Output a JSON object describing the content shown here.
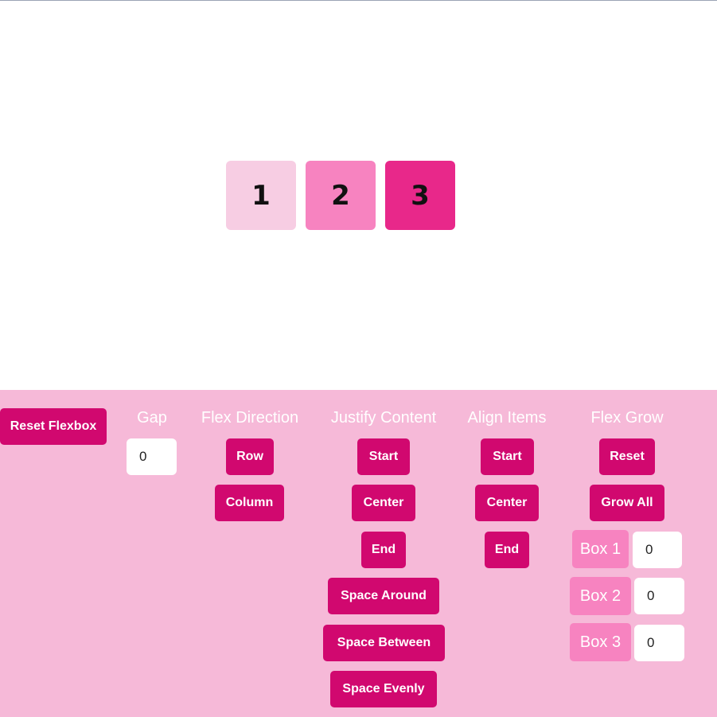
{
  "colors": {
    "box1": "#f7cde3",
    "box2": "#f783c0",
    "box3": "#e8288a",
    "button": "#d1086f",
    "panel": "#f6b9d8",
    "box_tag": "#f783c0"
  },
  "stage": {
    "boxes": [
      "1",
      "2",
      "3"
    ]
  },
  "controls": {
    "reset_flexbox": "Reset Flexbox",
    "gap": {
      "heading": "Gap",
      "value": "0"
    },
    "flex_direction": {
      "heading": "Flex Direction",
      "row": "Row",
      "column": "Column"
    },
    "justify_content": {
      "heading": "Justify Content",
      "start": "Start",
      "center": "Center",
      "end": "End",
      "space_around": "Space Around",
      "space_between": "Space Between",
      "space_evenly": "Space Evenly"
    },
    "align_items": {
      "heading": "Align Items",
      "start": "Start",
      "center": "Center",
      "end": "End"
    },
    "flex_grow": {
      "heading": "Flex Grow",
      "reset": "Reset",
      "grow_all": "Grow All",
      "boxes": [
        {
          "label": "Box 1",
          "value": "0"
        },
        {
          "label": "Box 2",
          "value": "0"
        },
        {
          "label": "Box 3",
          "value": "0"
        }
      ]
    }
  }
}
